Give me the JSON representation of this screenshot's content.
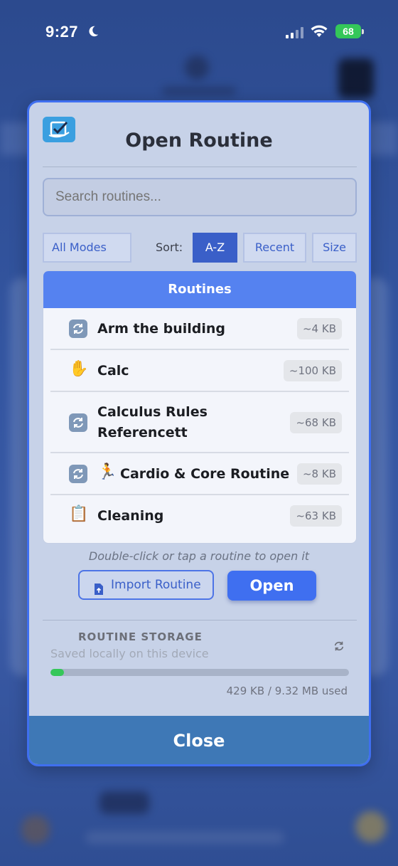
{
  "status_bar": {
    "time": "9:27",
    "battery": "68",
    "colors": {
      "battery": "#34c759"
    }
  },
  "modal": {
    "title": "Open Routine",
    "search": {
      "placeholder": "Search routines...",
      "value": ""
    },
    "mode_filter": "All Modes",
    "sort": {
      "label": "Sort:",
      "options": [
        "A-Z",
        "Recent",
        "Size"
      ],
      "selected": "A-Z"
    },
    "list": {
      "header": "Routines",
      "items": [
        {
          "icon": "cycle-icon",
          "name": "Arm the building",
          "size": "~4 KB"
        },
        {
          "icon": "raised-hand-icon",
          "name": "Calc",
          "size": "~100 KB"
        },
        {
          "icon": "cycle-icon",
          "name_lines": [
            "Calculus Rules",
            "Referencett"
          ],
          "size": "~68 KB"
        },
        {
          "icon": "cycle-icon",
          "icon2": "running-person-icon",
          "name": "Cardio & Core Routine",
          "size": "~8 KB"
        },
        {
          "icon": "clipboard-icon",
          "name": "Cleaning",
          "size": "~63 KB"
        }
      ]
    },
    "hint": "Double-click or tap a routine to open it",
    "import_label": "Import Routine",
    "open_label": "Open",
    "storage": {
      "label": "ROUTINE STORAGE",
      "subtitle": "Saved locally on this device",
      "used_text": "429 KB / 9.32 MB used",
      "used_fraction": 0.045
    },
    "close_label": "Close",
    "colors": {
      "accent": "#3f6ff0",
      "list_header": "#5582f0",
      "close_bar": "#3e78b6",
      "progress_fill": "#35c759"
    }
  }
}
